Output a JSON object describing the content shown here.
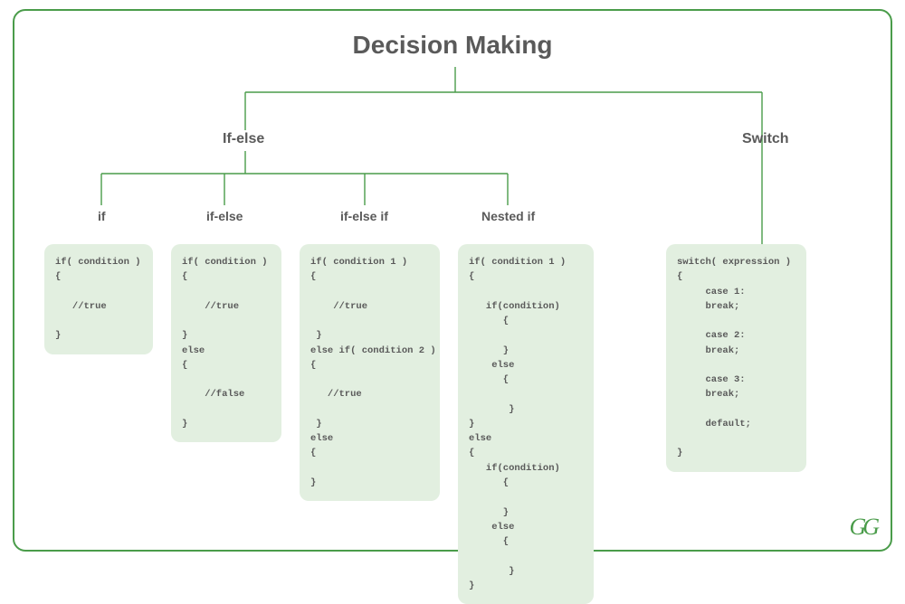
{
  "title": "Decision Making",
  "categories": {
    "ifelse": "If-else",
    "switch": "Switch"
  },
  "subs": {
    "if": "if",
    "ifelse": "if-else",
    "ifelseif": "if-else if",
    "nested": "Nested if"
  },
  "code": {
    "if": "if( condition )\n{\n\n   //true\n\n}",
    "ifelse": "if( condition )\n{\n\n    //true\n\n}\nelse\n{\n\n    //false\n\n}",
    "ifelseif": "if( condition 1 )\n{\n\n    //true\n\n }\nelse if( condition 2 )\n{\n\n   //true\n\n }\nelse\n{\n\n}",
    "nested": "if( condition 1 )\n{\n\n   if(condition)\n      {\n\n      }\n    else\n      {\n\n       }\n}\nelse\n{\n   if(condition)\n      {\n\n      }\n    else\n      {\n\n       }\n}",
    "switch": "switch( expression )\n{\n     case 1:\n     break;\n\n     case 2:\n     break;\n\n     case 3:\n     break;\n\n     default;\n\n}"
  },
  "logo": "GG",
  "colors": {
    "border": "#4a9c4a",
    "text": "#5a5a5a",
    "codebox": "#e2efe0"
  }
}
